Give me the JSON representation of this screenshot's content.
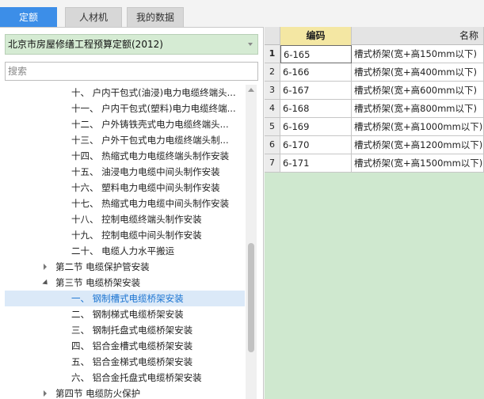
{
  "tabs": [
    {
      "label": "定额",
      "active": true
    },
    {
      "label": "人材机",
      "active": false
    },
    {
      "label": "我的数据",
      "active": false
    }
  ],
  "quota_selector": {
    "value": "北京市房屋修缮工程预算定额(2012)"
  },
  "search": {
    "placeholder": "搜索"
  },
  "tree": [
    {
      "label": "十、 户内干包式(油浸)电力电缆终端头...",
      "level": 3,
      "expander": "none",
      "selected": false
    },
    {
      "label": "十一、 户内干包式(塑料)电力电缆终端...",
      "level": 3,
      "expander": "none",
      "selected": false
    },
    {
      "label": "十二、 户外铸铁壳式电力电缆终端头...",
      "level": 3,
      "expander": "none",
      "selected": false
    },
    {
      "label": "十三、 户外干包式电力电缆终端头制...",
      "level": 3,
      "expander": "none",
      "selected": false
    },
    {
      "label": "十四、 热缩式电力电缆终端头制作安装",
      "level": 3,
      "expander": "none",
      "selected": false
    },
    {
      "label": "十五、 油浸电力电缆中间头制作安装",
      "level": 3,
      "expander": "none",
      "selected": false
    },
    {
      "label": "十六、 塑料电力电缆中间头制作安装",
      "level": 3,
      "expander": "none",
      "selected": false
    },
    {
      "label": "十七、 热缩式电力电缆中间头制作安装",
      "level": 3,
      "expander": "none",
      "selected": false
    },
    {
      "label": "十八、 控制电缆终端头制作安装",
      "level": 3,
      "expander": "none",
      "selected": false
    },
    {
      "label": "十九、 控制电缆中间头制作安装",
      "level": 3,
      "expander": "none",
      "selected": false
    },
    {
      "label": "二十、 电缆人力水平搬运",
      "level": 3,
      "expander": "none",
      "selected": false
    },
    {
      "label": "第二节 电缆保护管安装",
      "level": 2,
      "expander": "closed",
      "selected": false
    },
    {
      "label": "第三节 电缆桥架安装",
      "level": 2,
      "expander": "open",
      "selected": false
    },
    {
      "label": "一、 钢制槽式电缆桥架安装",
      "level": 3,
      "expander": "none",
      "selected": true
    },
    {
      "label": "二、 钢制梯式电缆桥架安装",
      "level": 3,
      "expander": "none",
      "selected": false
    },
    {
      "label": "三、 钢制托盘式电缆桥架安装",
      "level": 3,
      "expander": "none",
      "selected": false
    },
    {
      "label": "四、 铝合金槽式电缆桥架安装",
      "level": 3,
      "expander": "none",
      "selected": false
    },
    {
      "label": "五、 铝合金梯式电缆桥架安装",
      "level": 3,
      "expander": "none",
      "selected": false
    },
    {
      "label": "六、 铝合金托盘式电缆桥架安装",
      "level": 3,
      "expander": "none",
      "selected": false
    },
    {
      "label": "第四节 电缆防火保护",
      "level": 2,
      "expander": "closed",
      "selected": false
    }
  ],
  "grid": {
    "headers": {
      "code": "编码",
      "name": "名称"
    },
    "rows": [
      {
        "index": "1",
        "code": "6-165",
        "name": "槽式桥架(宽+高150mm以下)"
      },
      {
        "index": "2",
        "code": "6-166",
        "name": "槽式桥架(宽+高400mm以下)"
      },
      {
        "index": "3",
        "code": "6-167",
        "name": "槽式桥架(宽+高600mm以下)"
      },
      {
        "index": "4",
        "code": "6-168",
        "name": "槽式桥架(宽+高800mm以下)"
      },
      {
        "index": "5",
        "code": "6-169",
        "name": "槽式桥架(宽+高1000mm以下)"
      },
      {
        "index": "6",
        "code": "6-170",
        "name": "槽式桥架(宽+高1200mm以下)"
      },
      {
        "index": "7",
        "code": "6-171",
        "name": "槽式桥架(宽+高1500mm以下)"
      }
    ]
  },
  "colors": {
    "accent": "#3c8ee8",
    "selected_text": "#1b74d1",
    "grid_bg": "#cfe8cf",
    "code_header": "#f4e7a3"
  }
}
